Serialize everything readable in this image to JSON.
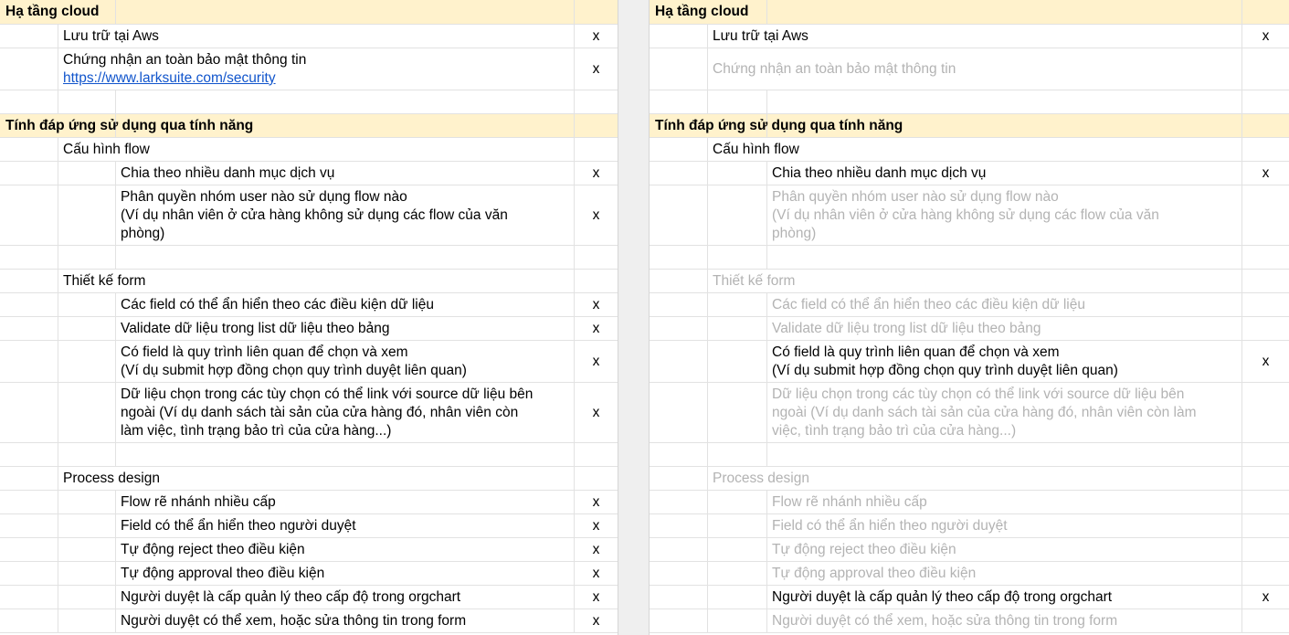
{
  "sheets": [
    {
      "id": "left",
      "rows": [
        {
          "type": "header",
          "h": 27,
          "text": "Hạ tầng cloud"
        },
        {
          "level": 1,
          "h": 26,
          "lines": [
            "Lưu trữ tại Aws"
          ],
          "x": "x"
        },
        {
          "level": 1,
          "h": 46,
          "lines": [
            "Chứng nhận an toàn bảo mật thông tin"
          ],
          "link": "https://www.larksuite.com/security",
          "x": "x"
        },
        {
          "type": "blank",
          "h": 26
        },
        {
          "type": "header",
          "h": 26,
          "text": "Tính đáp ứng sử dụng qua tính năng"
        },
        {
          "level": 1,
          "h": 26,
          "lines": [
            "Cấu hình flow"
          ]
        },
        {
          "level": 2,
          "h": 26,
          "lines": [
            "Chia theo nhiều danh mục dịch vụ"
          ],
          "x": "x"
        },
        {
          "level": 2,
          "h": 66,
          "lines": [
            "Phân quyền nhóm user nào sử dụng flow nào",
            "(Ví dụ nhân viên ở cửa hàng không sử dụng các flow của văn",
            "phòng)"
          ],
          "x": "x"
        },
        {
          "type": "blank",
          "h": 26
        },
        {
          "level": 1,
          "h": 26,
          "lines": [
            "Thiết kế form"
          ]
        },
        {
          "level": 2,
          "h": 26,
          "lines": [
            "Các field có thể ẩn hiển theo các điều kiện dữ liệu"
          ],
          "x": "x"
        },
        {
          "level": 2,
          "h": 26,
          "lines": [
            "Validate dữ liệu trong list dữ liệu theo bảng"
          ],
          "x": "x"
        },
        {
          "level": 2,
          "h": 46,
          "lines": [
            "Có field là quy trình liên quan để chọn và xem",
            "(Ví dụ submit hợp đồng chọn quy trình duyệt liên quan)"
          ],
          "x": "x"
        },
        {
          "level": 2,
          "h": 66,
          "lines": [
            "Dữ liệu chọn trong các tùy chọn có thể link với source dữ liệu bên",
            "ngoài (Ví dụ danh sách tài sản của cửa hàng đó, nhân viên còn",
            "làm việc, tình trạng bảo trì của cửa hàng...)"
          ],
          "x": "x"
        },
        {
          "type": "blank",
          "h": 26
        },
        {
          "level": 1,
          "h": 26,
          "lines": [
            "Process design"
          ]
        },
        {
          "level": 2,
          "h": 26,
          "lines": [
            "Flow rẽ nhánh nhiều cấp"
          ],
          "x": "x"
        },
        {
          "level": 2,
          "h": 26,
          "lines": [
            "Field có thể ẩn hiển theo người duyệt"
          ],
          "x": "x"
        },
        {
          "level": 2,
          "h": 26,
          "lines": [
            "Tự động reject theo điều kiện"
          ],
          "x": "x"
        },
        {
          "level": 2,
          "h": 26,
          "lines": [
            "Tự động approval theo điều kiện"
          ],
          "x": "x"
        },
        {
          "level": 2,
          "h": 26,
          "lines": [
            "Người duyệt là cấp quản lý theo cấp độ trong orgchart"
          ],
          "x": "x"
        },
        {
          "level": 2,
          "h": 26,
          "lines": [
            "Người duyệt có thể xem, hoặc sửa thông tin trong form"
          ],
          "x": "x"
        }
      ]
    },
    {
      "id": "right",
      "rows": [
        {
          "type": "header",
          "h": 27,
          "text": "Hạ tầng cloud"
        },
        {
          "level": 1,
          "h": 26,
          "lines": [
            "Lưu trữ tại Aws"
          ],
          "x": "x"
        },
        {
          "level": 1,
          "h": 46,
          "lines": [
            "Chứng nhận an toàn bảo mật thông tin"
          ],
          "muted": true
        },
        {
          "type": "blank",
          "h": 26
        },
        {
          "type": "header",
          "h": 26,
          "text": "Tính đáp ứng sử dụng qua tính năng"
        },
        {
          "level": 1,
          "h": 26,
          "lines": [
            "Cấu hình flow"
          ]
        },
        {
          "level": 2,
          "h": 26,
          "lines": [
            "Chia theo nhiều danh mục dịch vụ"
          ],
          "x": "x"
        },
        {
          "level": 2,
          "h": 66,
          "lines": [
            "Phân quyền nhóm user nào sử dụng flow nào",
            "(Ví dụ nhân viên ở cửa hàng không sử dụng các flow của văn",
            "phòng)"
          ],
          "muted": true
        },
        {
          "type": "blank",
          "h": 26
        },
        {
          "level": 1,
          "h": 26,
          "lines": [
            "Thiết kế form"
          ],
          "muted": true
        },
        {
          "level": 2,
          "h": 26,
          "lines": [
            "Các field có thể ẩn hiển theo các điều kiện dữ liệu"
          ],
          "muted": true
        },
        {
          "level": 2,
          "h": 26,
          "lines": [
            "Validate dữ liệu trong list dữ liệu theo bảng"
          ],
          "muted": true
        },
        {
          "level": 2,
          "h": 46,
          "lines": [
            "Có field là quy trình liên quan để chọn và xem",
            "(Ví dụ submit hợp đồng chọn quy trình duyệt liên quan)"
          ],
          "x": "x"
        },
        {
          "level": 2,
          "h": 66,
          "lines": [
            "Dữ liệu chọn trong các tùy chọn có thể link với source dữ liệu bên",
            "ngoài (Ví dụ danh sách tài sản của cửa hàng đó, nhân viên còn làm",
            "việc, tình trạng bảo trì của cửa hàng...)"
          ],
          "muted": true
        },
        {
          "type": "blank",
          "h": 26
        },
        {
          "level": 1,
          "h": 26,
          "lines": [
            "Process design"
          ],
          "muted": true
        },
        {
          "level": 2,
          "h": 26,
          "lines": [
            "Flow rẽ nhánh nhiều cấp"
          ],
          "muted": true
        },
        {
          "level": 2,
          "h": 26,
          "lines": [
            "Field có thể ẩn hiển theo người duyệt"
          ],
          "muted": true
        },
        {
          "level": 2,
          "h": 26,
          "lines": [
            "Tự động reject theo điều kiện"
          ],
          "muted": true
        },
        {
          "level": 2,
          "h": 26,
          "lines": [
            "Tự động approval theo điều kiện"
          ],
          "muted": true
        },
        {
          "level": 2,
          "h": 26,
          "lines": [
            "Người duyệt là cấp quản lý theo cấp độ trong orgchart"
          ],
          "x": "x"
        },
        {
          "level": 2,
          "h": 26,
          "lines": [
            "Người duyệt có thể xem, hoặc sửa thông tin trong form"
          ],
          "muted": true
        }
      ]
    }
  ],
  "colors": {
    "header_bg": "#fff2cc",
    "grid": "#e2e2e2",
    "muted_text": "#b3b3b3",
    "link": "#1155cc",
    "gap": "#efefef"
  }
}
